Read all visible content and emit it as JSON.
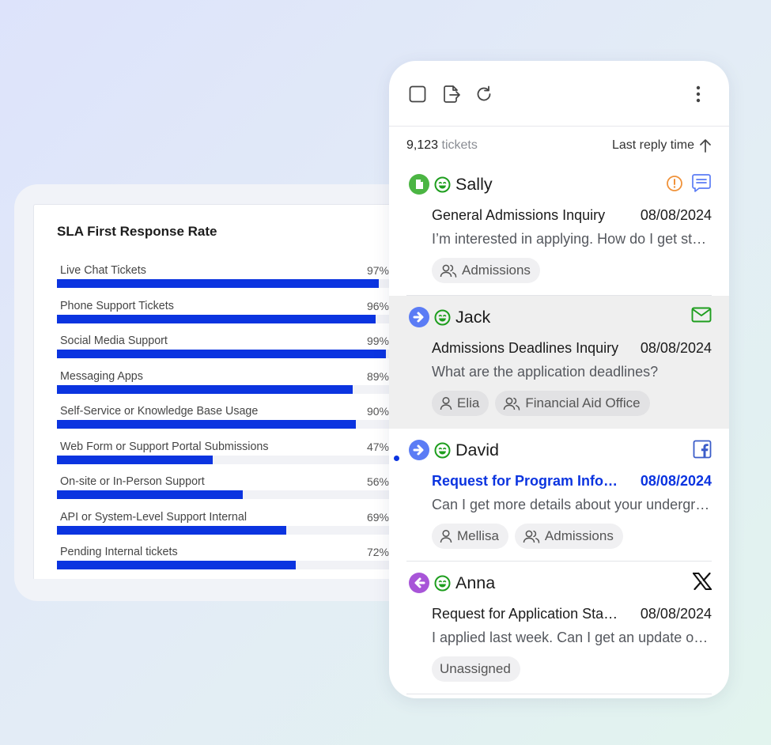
{
  "sla": {
    "title": "SLA First Response Rate",
    "rows": [
      {
        "label": "Live Chat Tickets",
        "pct_text": "97%",
        "value": 97
      },
      {
        "label": "Phone Support Tickets",
        "pct_text": "96%",
        "value": 96
      },
      {
        "label": "Social Media Support",
        "pct_text": "99%",
        "value": 99
      },
      {
        "label": "Messaging Apps",
        "pct_text": "89%",
        "value": 89
      },
      {
        "label": "Self-Service or Knowledge Base Usage",
        "pct_text": "90%",
        "value": 90
      },
      {
        "label": "Web Form or Support Portal Submissions",
        "pct_text": "47%",
        "value": 47
      },
      {
        "label": "On-site or In-Person Support",
        "pct_text": "56%",
        "value": 56
      },
      {
        "label": "API or System-Level Support Internal",
        "pct_text": "69%",
        "value": 69
      },
      {
        "label": "Pending Internal tickets",
        "pct_text": "72%",
        "value": 72
      }
    ],
    "bar_color": "#0b34e0"
  },
  "tickets_panel": {
    "count_number": "9,123",
    "count_word": "tickets",
    "sort_label": "Last reply time",
    "toolbar_icons": [
      "checkbox-icon",
      "export-icon",
      "refresh-icon",
      "more-vertical-icon"
    ],
    "tickets": [
      {
        "name": "Sally",
        "status_icon": "new-document-icon",
        "status_color": "#4bb543",
        "subject": "General Admissions Inquiry",
        "date": "08/08/2024",
        "preview": "I’m interested in applying. How do I get started?",
        "right_icons": [
          "alert-icon",
          "chat-icon"
        ],
        "tags": [
          {
            "icon": "group-icon",
            "label": "Admissions"
          }
        ]
      },
      {
        "name": "Jack",
        "status_icon": "arrow-right-icon",
        "status_color": "#5b7cf5",
        "subject": "Admissions Deadlines Inquiry",
        "date": "08/08/2024",
        "preview": "What are the application deadlines?",
        "right_icons": [
          "email-icon"
        ],
        "tags": [
          {
            "icon": "person-icon",
            "label": "Elia"
          },
          {
            "icon": "group-icon",
            "label": "Financial Aid Office"
          }
        ]
      },
      {
        "name": "David",
        "status_icon": "arrow-right-icon",
        "status_color": "#5b7cf5",
        "subject": "Request for Program Information",
        "date": "08/08/2024",
        "preview": "Can I get more details about your undergraduate programs?",
        "right_icons": [
          "facebook-icon"
        ],
        "tags": [
          {
            "icon": "person-icon",
            "label": "Mellisa"
          },
          {
            "icon": "group-icon",
            "label": "Admissions"
          }
        ]
      },
      {
        "name": "Anna",
        "status_icon": "arrow-left-icon",
        "status_color": "#a855d8",
        "subject": "Request for Application Status",
        "date": "08/08/2024",
        "preview": "I applied last week. Can I get an update on my status?",
        "right_icons": [
          "x-icon"
        ],
        "tags": [
          {
            "label": "Unassigned"
          }
        ]
      }
    ]
  }
}
